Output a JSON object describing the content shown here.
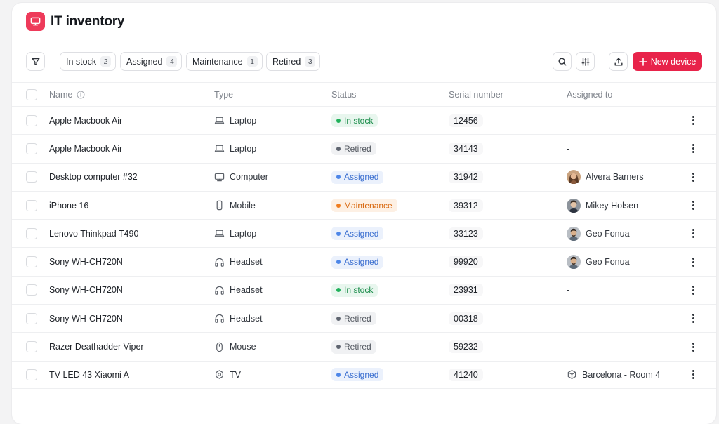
{
  "app": {
    "title": "IT inventory",
    "icon": "monitor-icon"
  },
  "filters": [
    {
      "label": "In stock",
      "count": "2"
    },
    {
      "label": "Assigned",
      "count": "4"
    },
    {
      "label": "Maintenance",
      "count": "1"
    },
    {
      "label": "Retired",
      "count": "3"
    }
  ],
  "toolbar": {
    "new_device_label": "New device",
    "accent": "#e8234a"
  },
  "columns": {
    "name": "Name",
    "type": "Type",
    "status": "Status",
    "serial": "Serial number",
    "assigned": "Assigned to"
  },
  "status_colors": {
    "In stock": {
      "bg": "#e8f6ee",
      "dot": "#20b15a",
      "text": "#1a8c4a"
    },
    "Retired": {
      "bg": "#f0f1f3",
      "dot": "#5f6570",
      "text": "#50555d"
    },
    "Assigned": {
      "bg": "#ebf1fc",
      "dot": "#4d86e8",
      "text": "#3b6fd0"
    },
    "Maintenance": {
      "bg": "#fdf0e4",
      "dot": "#f07d1f",
      "text": "#d8660c"
    }
  },
  "rows": [
    {
      "name": "Apple Macbook Air",
      "type": "Laptop",
      "type_icon": "laptop-icon",
      "status": "In stock",
      "serial": "12456",
      "assigned": "-",
      "assigned_kind": "none"
    },
    {
      "name": "Apple Macbook Air",
      "type": "Laptop",
      "type_icon": "laptop-icon",
      "status": "Retired",
      "serial": "34143",
      "assigned": "-",
      "assigned_kind": "none"
    },
    {
      "name": "Desktop computer #32",
      "type": "Computer",
      "type_icon": "monitor-icon",
      "status": "Assigned",
      "serial": "31942",
      "assigned": "Alvera Barners",
      "assigned_kind": "person"
    },
    {
      "name": "iPhone 16",
      "type": "Mobile",
      "type_icon": "mobile-icon",
      "status": "Maintenance",
      "serial": "39312",
      "assigned": "Mikey Holsen",
      "assigned_kind": "person"
    },
    {
      "name": "Lenovo Thinkpad T490",
      "type": "Laptop",
      "type_icon": "laptop-icon",
      "status": "Assigned",
      "serial": "33123",
      "assigned": "Geo Fonua",
      "assigned_kind": "person"
    },
    {
      "name": "Sony WH-CH720N",
      "type": "Headset",
      "type_icon": "headset-icon",
      "status": "Assigned",
      "serial": "99920",
      "assigned": "Geo Fonua",
      "assigned_kind": "person"
    },
    {
      "name": "Sony WH-CH720N",
      "type": "Headset",
      "type_icon": "headset-icon",
      "status": "In stock",
      "serial": "23931",
      "assigned": "-",
      "assigned_kind": "none"
    },
    {
      "name": "Sony WH-CH720N",
      "type": "Headset",
      "type_icon": "headset-icon",
      "status": "Retired",
      "serial": "00318",
      "assigned": "-",
      "assigned_kind": "none"
    },
    {
      "name": "Razer Deathadder Viper",
      "type": "Mouse",
      "type_icon": "mouse-icon",
      "status": "Retired",
      "serial": "59232",
      "assigned": "-",
      "assigned_kind": "none"
    },
    {
      "name": "TV LED 43 Xiaomi A",
      "type": "TV",
      "type_icon": "tv-icon",
      "status": "Assigned",
      "serial": "41240",
      "assigned": "Barcelona - Room 4",
      "assigned_kind": "location"
    }
  ]
}
